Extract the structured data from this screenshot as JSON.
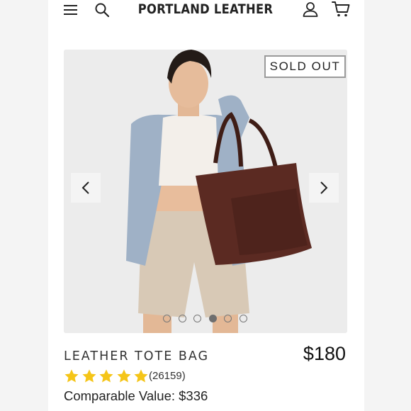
{
  "header": {
    "brand": "PORTLAND LEATHER",
    "menu_icon": "hamburger-menu-icon",
    "search_icon": "search-icon",
    "account_icon": "user-account-icon",
    "cart_icon": "shopping-cart-icon"
  },
  "product": {
    "badge": "SOLD OUT",
    "title": "LEATHER TOTE BAG",
    "price": "$180",
    "rating": 5,
    "review_count": "(26159)",
    "comparable_value": "Comparable Value: $336",
    "image_carousel": {
      "total_images": 6,
      "active_index": 3,
      "prev_icon": "chevron-left-icon",
      "next_icon": "chevron-right-icon"
    }
  },
  "colors": {
    "star": "#f5c518",
    "background": "#ebebeb",
    "badge_border": "#9a9a9a"
  }
}
